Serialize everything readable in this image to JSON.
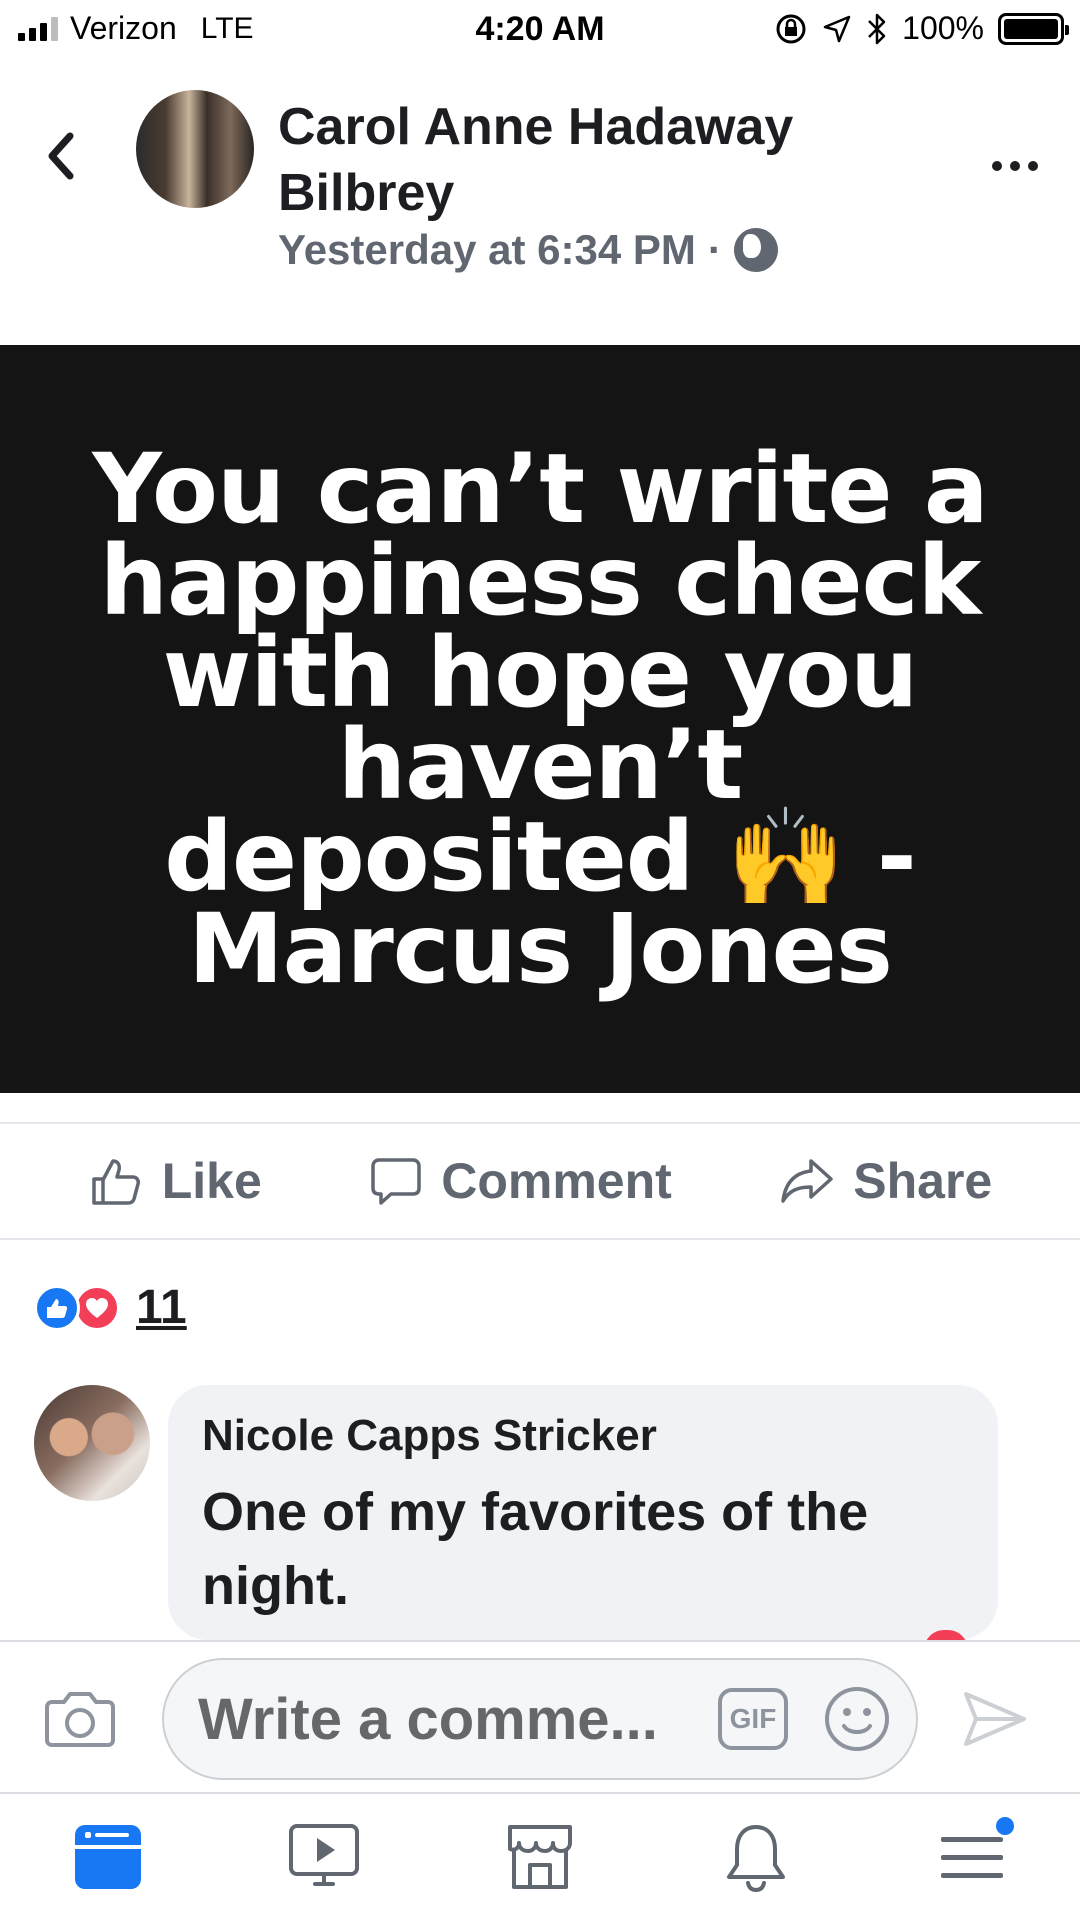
{
  "status_bar": {
    "carrier": "Verizon",
    "network": "LTE",
    "time": "4:20 AM",
    "battery": "100%",
    "battery_level": 1.0
  },
  "post": {
    "author": "Carol Anne Hadaway Bilbrey",
    "timestamp": "Yesterday at 6:34 PM",
    "separator": "·",
    "quote_line1": "You can’t write a",
    "quote_line2": "happiness check",
    "quote_line3": "with hope you",
    "quote_line4": "haven’t",
    "quote_line5": "deposited 🙌 -",
    "quote_line6": "Marcus Jones"
  },
  "actions": {
    "like": "Like",
    "comment": "Comment",
    "share": "Share"
  },
  "reactions": {
    "count": "11"
  },
  "comment": {
    "author": "Nicole Capps Stricker",
    "text": "One of my favorites of the night."
  },
  "composer": {
    "placeholder": "Write a comme...",
    "gif_label": "GIF"
  },
  "colors": {
    "accent": "#1877f2",
    "love": "#f33e58",
    "quote_bg": "#141414",
    "text_secondary": "#606770"
  },
  "bottom_nav": [
    "news-feed-icon",
    "watch-icon",
    "marketplace-icon",
    "notifications-icon",
    "menu-icon"
  ]
}
